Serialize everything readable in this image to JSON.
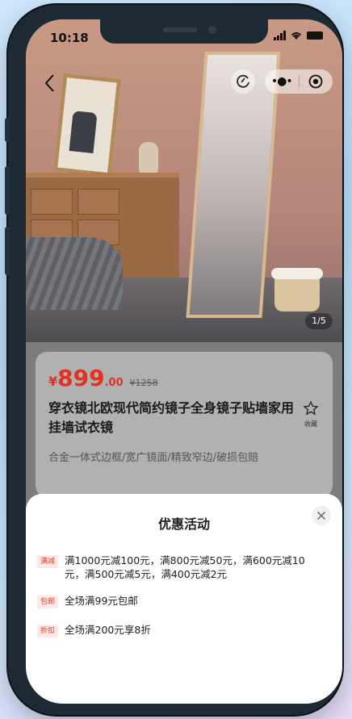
{
  "status": {
    "time": "10:18"
  },
  "nav": {
    "image_counter": "1/5"
  },
  "product": {
    "currency": "¥",
    "price_int": "899",
    "price_dec": ".00",
    "original_price": "¥1258",
    "title": "穿衣镜北欧现代简约镜子全身镜子贴墙家用挂墙试衣镜",
    "subtitle": "合金一体式边框/宽广镜面/精致窄边/破损包赔",
    "favorite_label": "收藏"
  },
  "sheet": {
    "title": "优惠活动",
    "promos": [
      {
        "tag": "满减",
        "text": "满1000元减100元，满800元减50元，满600元减10元，满500元减5元，满400元减2元"
      },
      {
        "tag": "包邮",
        "text": "全场满99元包邮"
      },
      {
        "tag": "折扣",
        "text": "全场满200元享8折"
      }
    ]
  },
  "colors": {
    "price": "#e0321f",
    "tag_text": "#e23c2d",
    "tag_bg": "#fde8e5"
  },
  "icons": [
    "back-icon",
    "refresh-icon",
    "more-icon",
    "close-mini-program-icon",
    "star-icon",
    "close-icon"
  ]
}
